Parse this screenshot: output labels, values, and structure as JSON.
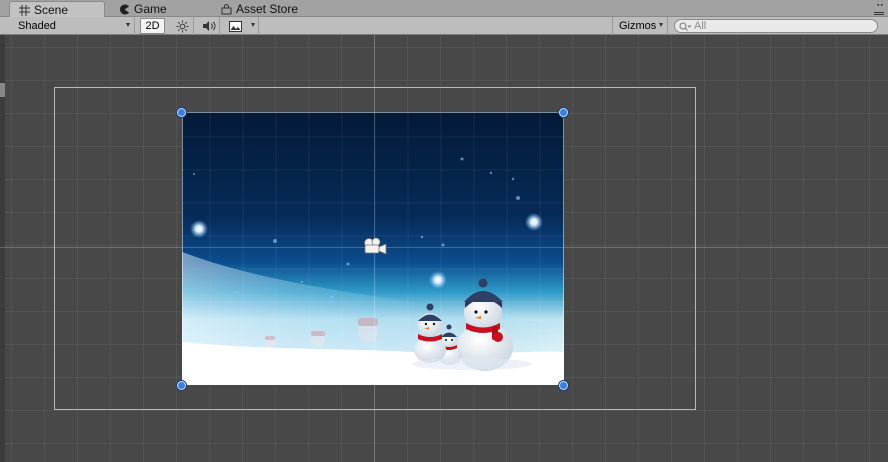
{
  "tabs": [
    {
      "label": "Scene",
      "icon": "grid-icon",
      "active": true
    },
    {
      "label": "Game",
      "icon": "pacman-icon",
      "active": false
    },
    {
      "label": "Asset Store",
      "icon": "bag-icon",
      "active": false
    }
  ],
  "toolbar": {
    "shading_mode": "Shaded",
    "mode_2d": "2D",
    "lighting_icon": "sun-icon",
    "audio_icon": "speaker-icon",
    "effects_icon": "image-icon",
    "gizmos": "Gizmos",
    "search_placeholder": "All"
  },
  "colors": {
    "sky_top": "#041c3c",
    "sky_mid": "#0a3c74",
    "horizon": "#1a8cc0",
    "snow": "#ffffff",
    "handle": "#3d7fdc",
    "scene_bg": "#484848"
  }
}
